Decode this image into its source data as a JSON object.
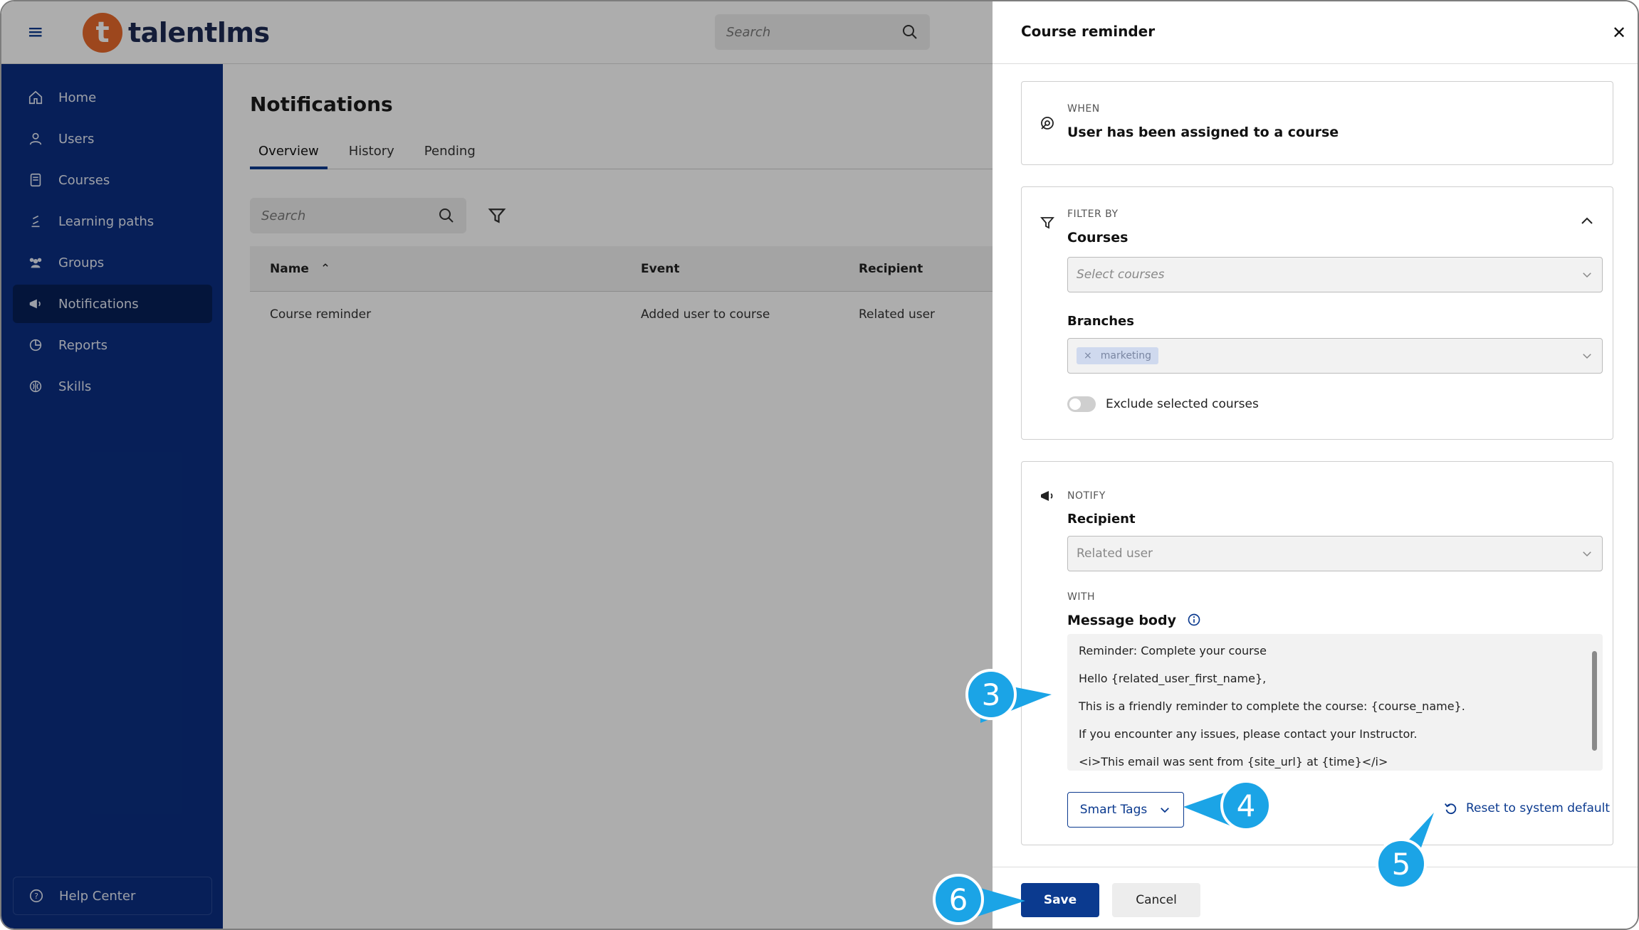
{
  "app": {
    "logo_mark": "t",
    "logo_text": "talentlms",
    "search_placeholder": "Search"
  },
  "sidebar": {
    "items": [
      {
        "label": "Home",
        "icon": "home-icon"
      },
      {
        "label": "Users",
        "icon": "user-icon"
      },
      {
        "label": "Courses",
        "icon": "book-icon"
      },
      {
        "label": "Learning paths",
        "icon": "path-icon"
      },
      {
        "label": "Groups",
        "icon": "groups-icon"
      },
      {
        "label": "Notifications",
        "icon": "megaphone-icon",
        "active": true
      },
      {
        "label": "Reports",
        "icon": "pie-chart-icon"
      },
      {
        "label": "Skills",
        "icon": "brain-icon"
      }
    ],
    "help_label": "Help Center"
  },
  "main": {
    "title": "Notifications",
    "tabs": [
      {
        "label": "Overview",
        "active": true
      },
      {
        "label": "History"
      },
      {
        "label": "Pending"
      }
    ],
    "search_placeholder": "Search",
    "table": {
      "headers": [
        "Name",
        "Event",
        "Recipient"
      ],
      "rows": [
        [
          "Course reminder",
          "Added user to course",
          "Related user"
        ]
      ]
    }
  },
  "drawer": {
    "title": "Course reminder",
    "when": {
      "eyebrow": "WHEN",
      "value": "User has been assigned to a course"
    },
    "filter": {
      "eyebrow": "FILTER BY",
      "courses_label": "Courses",
      "courses_placeholder": "Select courses",
      "branches_label": "Branches",
      "branch_chip": "marketing",
      "chip_remove": "×",
      "exclude_label": "Exclude selected courses"
    },
    "notify": {
      "eyebrow": "NOTIFY",
      "recipient_label": "Recipient",
      "recipient_value": "Related user",
      "with_eyebrow": "WITH",
      "message_label": "Message body",
      "message_lines": [
        "Reminder: Complete your course",
        "Hello {related_user_first_name},",
        "This is a friendly reminder to complete the course: {course_name}.",
        "If you encounter any issues, please contact your Instructor.",
        "<i>This email was sent from {site_url} at {time}</i>"
      ],
      "smart_tags_label": "Smart Tags",
      "reset_label": "Reset to system default"
    },
    "save_label": "Save",
    "cancel_label": "Cancel"
  },
  "callouts": [
    "3",
    "4",
    "5",
    "6"
  ],
  "colors": {
    "sidebar": "#0b2f82",
    "primary": "#0b3a8f",
    "brand_orange": "#e8692b",
    "callout": "#1ba4e6"
  }
}
